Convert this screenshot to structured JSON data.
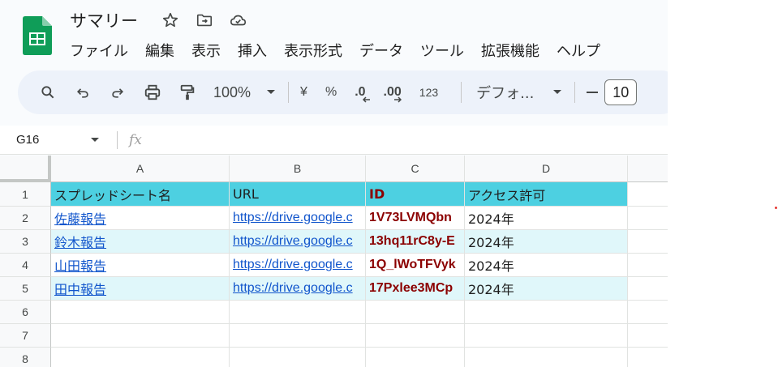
{
  "app": {
    "title": "サマリー",
    "menu": [
      "ファイル",
      "編集",
      "表示",
      "挿入",
      "表示形式",
      "データ",
      "ツール",
      "拡張機能",
      "ヘルプ"
    ]
  },
  "toolbar": {
    "zoom": "100%",
    "currency": "¥",
    "percent": "%",
    "decrease_decimal": ".0",
    "increase_decimal": ".00",
    "number_format": "123",
    "font": "デフォ...",
    "font_size": "10",
    "minus": "−"
  },
  "formula_bar": {
    "cell_ref": "G16",
    "fx": "fx"
  },
  "grid": {
    "columns": [
      "A",
      "B",
      "C",
      "D"
    ],
    "rows": [
      "1",
      "2",
      "3",
      "4",
      "5",
      "6",
      "7",
      "8"
    ],
    "header": [
      "スプレッドシート名",
      "URL",
      "ID",
      "アクセス許可"
    ],
    "data": [
      [
        "佐藤報告",
        "https://drive.google.c",
        "1V73LVMQbn",
        "2024年"
      ],
      [
        "鈴木報告",
        "https://drive.google.c",
        "13hq11rC8y-E",
        "2024年"
      ],
      [
        "山田報告",
        "https://drive.google.c",
        "1Q_lWoTFVyk",
        "2024年"
      ],
      [
        "田中報告",
        "https://drive.google.c",
        "17Pxlee3MCp",
        "2024年"
      ]
    ]
  },
  "colors": {
    "header_fill": "#4dd0e1",
    "band_fill": "#e0f7fa",
    "link": "#1155cc",
    "id_text": "#8b0000",
    "sheets_green": "#0f9d58"
  }
}
